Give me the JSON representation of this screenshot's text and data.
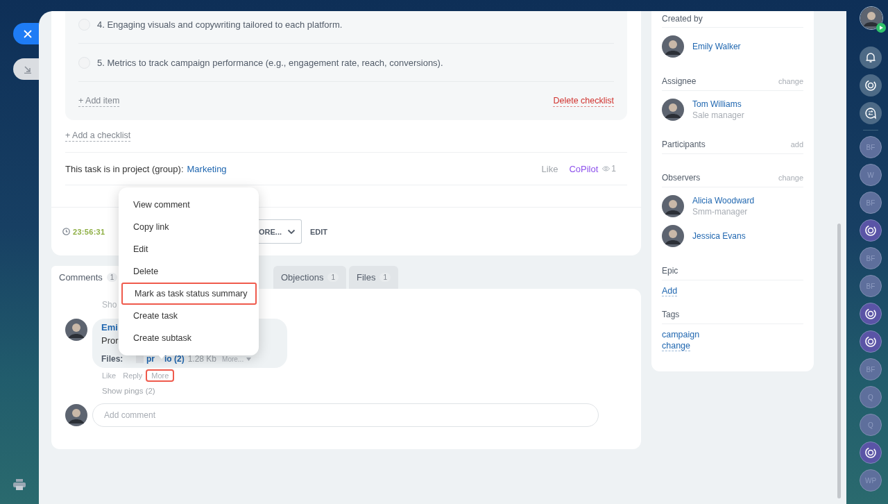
{
  "left_rail": {
    "buttons": [
      {
        "kind": "close",
        "active": true
      },
      {
        "kind": "collapse",
        "active": false
      }
    ]
  },
  "checklist": {
    "items": [
      {
        "text": "4. Engaging visuals and copywriting tailored to each platform.",
        "checked": false
      },
      {
        "text": "5. Metrics to track campaign performance (e.g., engagement rate, reach, conversions).",
        "checked": false
      }
    ],
    "add_item": "+ Add item",
    "delete": "Delete checklist"
  },
  "add_checklist": "+ Add a checklist",
  "project": {
    "label": "This task is in project (group):",
    "link": "Marketing",
    "like": "Like",
    "copilot": "CoPilot",
    "views": "1"
  },
  "footer": {
    "timer": "23:56:31",
    "more_button": "ORE...",
    "edit_button": "EDIT"
  },
  "tabs": [
    {
      "label": "Comments",
      "count": "1",
      "selected": true
    },
    {
      "label": "Objections",
      "count": "1",
      "selected": false
    },
    {
      "label": "Files",
      "count": "1",
      "selected": false
    }
  ],
  "comment": {
    "show_more": "Sho",
    "author": "Emi",
    "text": "Pror",
    "files_label": "Files:",
    "file_start": "pr",
    "file_end": "io (2)",
    "file_size": "1.28 Kb",
    "file_more": "More...",
    "actions": [
      {
        "label": "Like",
        "highlighted": false
      },
      {
        "label": "Reply",
        "highlighted": false
      },
      {
        "label": "More",
        "highlighted": true
      }
    ],
    "show_pings": "Show pings (2)",
    "add_comment_placeholder": "Add comment"
  },
  "context_menu": [
    {
      "label": "View comment",
      "highlighted": false
    },
    {
      "label": "Copy link",
      "highlighted": false
    },
    {
      "label": "Edit",
      "highlighted": false
    },
    {
      "label": "Delete",
      "highlighted": false
    },
    {
      "label": "Mark as task status summary",
      "highlighted": true
    },
    {
      "label": "Create task",
      "highlighted": false
    },
    {
      "label": "Create subtask",
      "highlighted": false
    }
  ],
  "sidebar": {
    "sections": [
      {
        "title": "Created by",
        "people": [
          {
            "name": "Emily Walker"
          }
        ]
      },
      {
        "title": "Assignee",
        "action": "change",
        "people": [
          {
            "name": "Tom Williams",
            "role": "Sale manager"
          }
        ]
      },
      {
        "title": "Participants",
        "action": "add"
      },
      {
        "title": "Observers",
        "action": "change",
        "people": [
          {
            "name": "Alicia Woodward",
            "role": "Smm-manager"
          },
          {
            "name": "Jessica Evans"
          }
        ]
      },
      {
        "title": "Epic",
        "links": [
          "Add"
        ]
      },
      {
        "title": "Tags",
        "links": [
          "campaign",
          "change"
        ]
      }
    ]
  },
  "right_rail": [
    {
      "kind": "user_photo"
    },
    {
      "kind": "bell"
    },
    {
      "kind": "copilot"
    },
    {
      "kind": "chat"
    },
    {
      "kind": "divider"
    },
    {
      "kind": "initials",
      "text": "BF"
    },
    {
      "kind": "initials",
      "text": "W"
    },
    {
      "kind": "initials",
      "text": "BF"
    },
    {
      "kind": "copilot_group"
    },
    {
      "kind": "initials",
      "text": "BF"
    },
    {
      "kind": "initials",
      "text": "BF"
    },
    {
      "kind": "copilot_group"
    },
    {
      "kind": "copilot_group"
    },
    {
      "kind": "initials",
      "text": "BF"
    },
    {
      "kind": "initials",
      "text": "Q"
    },
    {
      "kind": "initials",
      "text": "Q"
    },
    {
      "kind": "copilot_group"
    },
    {
      "kind": "initials",
      "text": "WP"
    }
  ]
}
